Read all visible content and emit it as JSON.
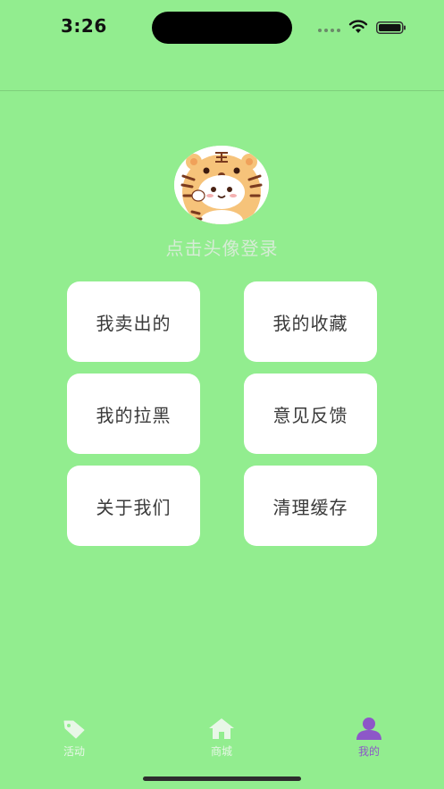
{
  "status_bar": {
    "time": "3:26"
  },
  "profile": {
    "login_prompt": "点击头像登录"
  },
  "menu": {
    "items": [
      {
        "label": "我卖出的"
      },
      {
        "label": "我的收藏"
      },
      {
        "label": "我的拉黑"
      },
      {
        "label": "意见反馈"
      },
      {
        "label": "关于我们"
      },
      {
        "label": "清理缓存"
      }
    ]
  },
  "tab_bar": {
    "items": [
      {
        "label": "活动",
        "icon": "tag-icon"
      },
      {
        "label": "商城",
        "icon": "home-icon"
      },
      {
        "label": "我的",
        "icon": "person-icon",
        "active": true
      }
    ],
    "active_color": "#8d57c8",
    "inactive_color": "#e8f7e7"
  },
  "colors": {
    "background": "#92ed8f"
  }
}
